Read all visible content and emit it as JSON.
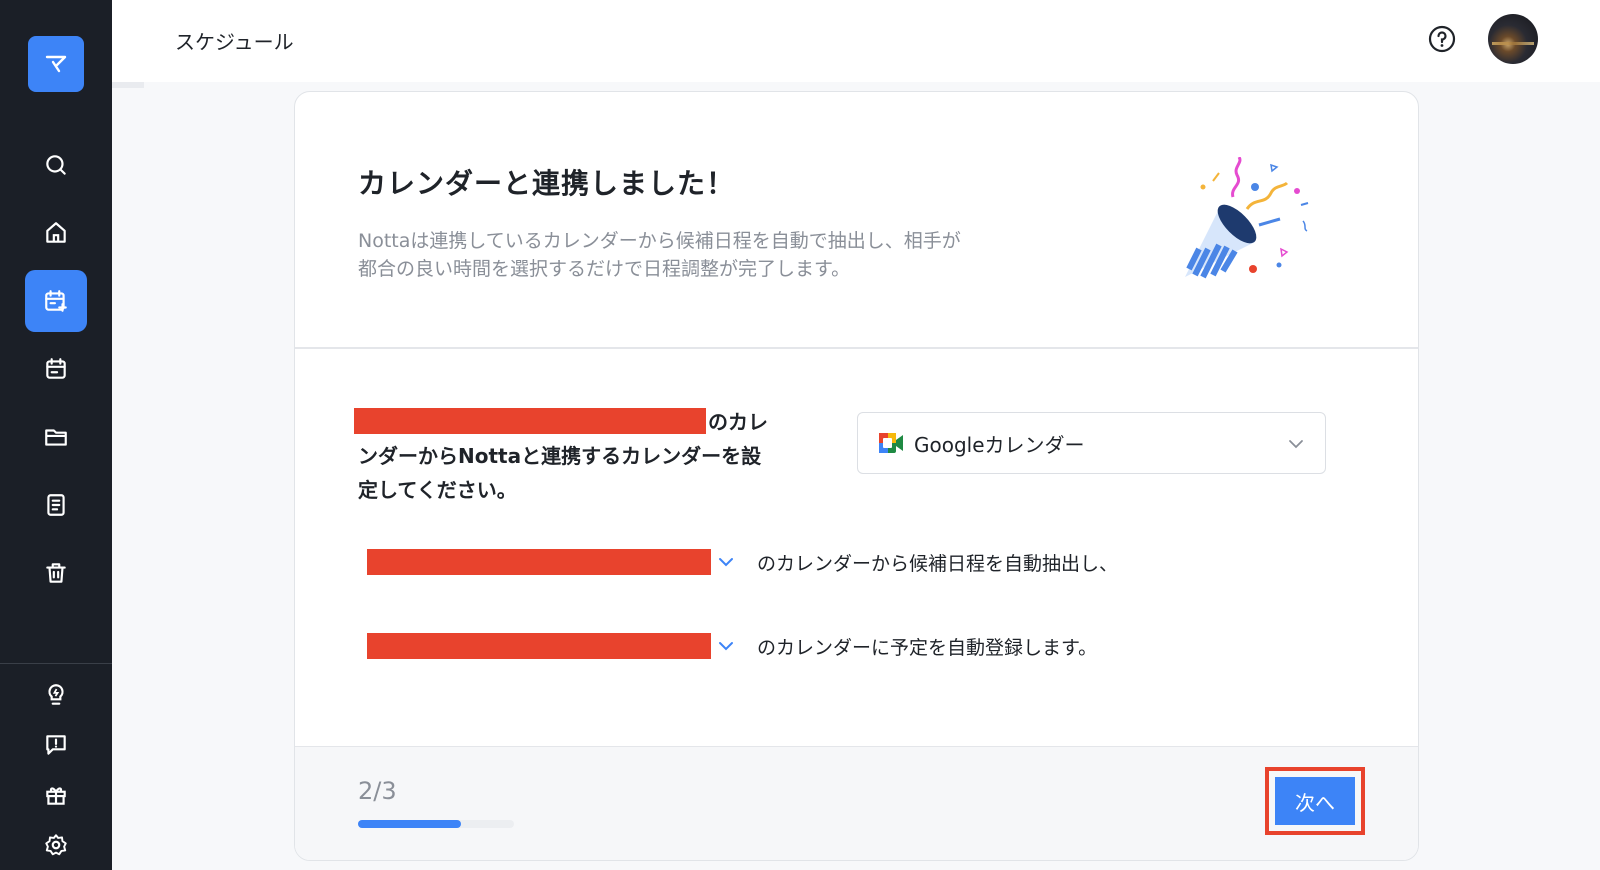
{
  "header": {
    "title": "スケジュール"
  },
  "sidebar": {
    "items": [
      {
        "name": "search",
        "icon": "search-icon"
      },
      {
        "name": "home",
        "icon": "home-icon"
      },
      {
        "name": "schedule",
        "icon": "calendar-plus-icon",
        "active": true
      },
      {
        "name": "calendar",
        "icon": "calendar-icon"
      },
      {
        "name": "folder",
        "icon": "folder-icon"
      },
      {
        "name": "notes",
        "icon": "document-icon"
      },
      {
        "name": "trash",
        "icon": "trash-icon"
      },
      {
        "name": "tips",
        "icon": "lightbulb-icon"
      },
      {
        "name": "feedback",
        "icon": "feedback-icon"
      },
      {
        "name": "gift",
        "icon": "gift-icon"
      },
      {
        "name": "settings",
        "icon": "gear-icon"
      }
    ]
  },
  "card": {
    "title": "カレンダーと連携しました！",
    "description_line1": "Nottaは連携しているカレンダーから候補日程を自動で抽出し、相手が",
    "description_line2": "都合の良い時間を選択するだけで日程調整が完了します。",
    "setup_text": "のカレンダーからNottaと連携するカレンダーを設定してください。",
    "calendar_select": {
      "value": "Googleカレンダー"
    },
    "row1_text": "のカレンダーから候補日程を自動抽出し、",
    "row2_text": "のカレンダーに予定を自動登録します。"
  },
  "footer": {
    "step": "2/3",
    "progress": 0.66,
    "next_label": "次へ"
  },
  "colors": {
    "accent": "#3d84f7",
    "sidebar_bg": "#1b1f27",
    "redaction": "#e8432d"
  }
}
